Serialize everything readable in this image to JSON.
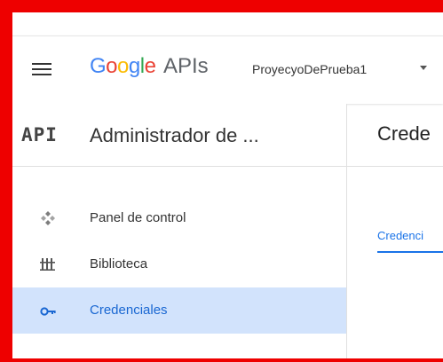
{
  "header": {
    "logo": {
      "google_letters": [
        "G",
        "o",
        "o",
        "g",
        "l",
        "e"
      ],
      "apis_text": "APIs"
    },
    "project_name": "ProyecyoDePrueba1"
  },
  "sidebar": {
    "badge": "API",
    "title": "Administrador de ...",
    "items": [
      {
        "label": "Panel de control",
        "icon": "dashboard-icon",
        "active": false
      },
      {
        "label": "Biblioteca",
        "icon": "library-icon",
        "active": false
      },
      {
        "label": "Credenciales",
        "icon": "key-icon",
        "active": true
      }
    ]
  },
  "main": {
    "title": "Crede",
    "tab_label": "Credenci"
  },
  "colors": {
    "border_highlight": "#ee0000",
    "active_item_bg": "#d2e3fc",
    "active_item_text": "#1967d2",
    "link_blue": "#1a73e8"
  }
}
